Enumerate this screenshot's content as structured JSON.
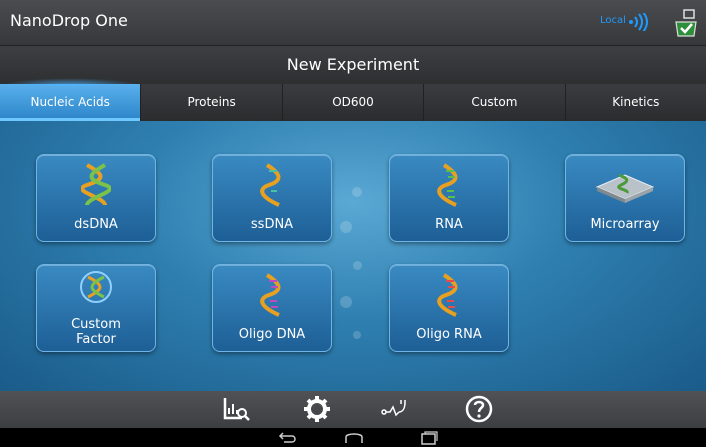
{
  "titlebar": {
    "app_title": "NanoDrop One",
    "local_label": "Local"
  },
  "header": {
    "title": "New Experiment"
  },
  "tabs": [
    {
      "label": "Nucleic Acids",
      "active": true
    },
    {
      "label": "Proteins",
      "active": false
    },
    {
      "label": "OD600",
      "active": false
    },
    {
      "label": "Custom",
      "active": false
    },
    {
      "label": "Kinetics",
      "active": false
    }
  ],
  "tiles": [
    {
      "label": "dsDNA",
      "icon": "dna-helix-icon"
    },
    {
      "label": "ssDNA",
      "icon": "dna-helix-icon"
    },
    {
      "label": "RNA",
      "icon": "rna-helix-icon"
    },
    {
      "label": "Microarray",
      "icon": "microarray-icon"
    },
    {
      "label_line1": "Custom",
      "label_line2": "Factor",
      "icon": "custom-factor-icon"
    },
    {
      "label": "Oligo DNA",
      "icon": "dna-helix-icon"
    },
    {
      "label": "Oligo RNA",
      "icon": "rna-helix-icon"
    }
  ],
  "toolbar": {
    "items": [
      "data-viewer-icon",
      "settings-gear-icon",
      "diagnostics-icon",
      "help-icon"
    ]
  },
  "navbar": {
    "items": [
      "back-icon",
      "home-icon",
      "recents-icon"
    ]
  },
  "colors": {
    "accent": "#1e9bff",
    "tab_active": "#3a96d8",
    "tile": "#2a74ad"
  }
}
